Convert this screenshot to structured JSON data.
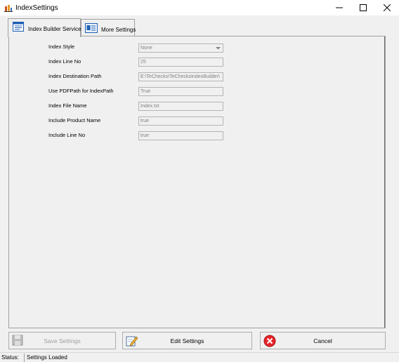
{
  "window": {
    "title": "IndexSettings"
  },
  "tabs": [
    {
      "label": "Index Builder Service",
      "icon": "index-list-icon",
      "active": true
    },
    {
      "label": "More Settings",
      "icon": "settings-card-icon",
      "active": false
    }
  ],
  "form": {
    "fields": [
      {
        "label": "Index Style",
        "value": "None",
        "type": "dropdown"
      },
      {
        "label": "Index Line No",
        "value": "25",
        "type": "text"
      },
      {
        "label": "Index Destination Path",
        "value": "E:\\TeChecks\\TeChecksIndexBuilder\\",
        "type": "text"
      },
      {
        "label": "Use PDFPath for IndexPath",
        "value": "True",
        "type": "text"
      },
      {
        "label": "Index File Name",
        "value": "Index.txt",
        "type": "text"
      },
      {
        "label": "Include Product Name",
        "value": "true",
        "type": "text"
      },
      {
        "label": "Include Line No",
        "value": "true",
        "type": "text"
      }
    ]
  },
  "buttons": {
    "save": {
      "label": "Save Settings",
      "icon": "floppy-disk-icon",
      "enabled": false
    },
    "edit": {
      "label": "Edit Settings",
      "icon": "edit-pencil-icon",
      "enabled": true
    },
    "cancel": {
      "label": "Cancel",
      "icon": "cancel-x-icon",
      "enabled": true
    }
  },
  "status": {
    "label": "Status:",
    "text": "Settings Loaded"
  },
  "colors": {
    "cancel_red": "#e8252a",
    "tab_icon_blue": "#1e5fb4"
  }
}
